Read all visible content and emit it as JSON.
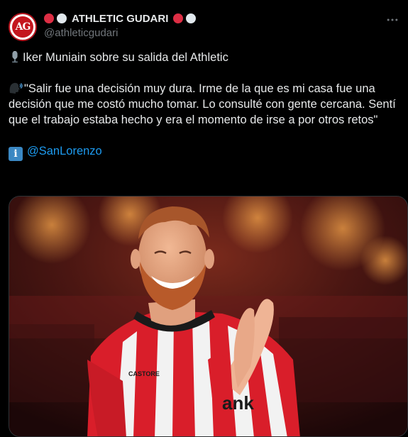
{
  "tweet": {
    "account": {
      "display_name": "ATHLETIC GUDARI",
      "handle": "@athleticgudari",
      "avatar_text": "AG",
      "badge_colors": [
        "#dd2e44",
        "#e1e8ed"
      ]
    },
    "more_icon": "more-horizontal-icon",
    "text": {
      "line1": "Iker Muniain sobre su salida del Athletic",
      "line1_icon": "microphone-icon",
      "quote": "\"Salir fue una decisión muy dura. Irme de la que es mi casa fue una decisión que me costó mucho tomar. Lo consulté con gente cercana. Sentí que el trabajo estaba hecho y era el momento de irse a por otros retos\"",
      "quote_icon": "speaking-head-icon",
      "info_icon": "information-icon",
      "info_icon_glyph": "i",
      "mention": "@SanLorenzo"
    },
    "media": {
      "kind": "photo",
      "shirt_text_1": "CASTORE",
      "shirt_text_2": "ank"
    }
  }
}
